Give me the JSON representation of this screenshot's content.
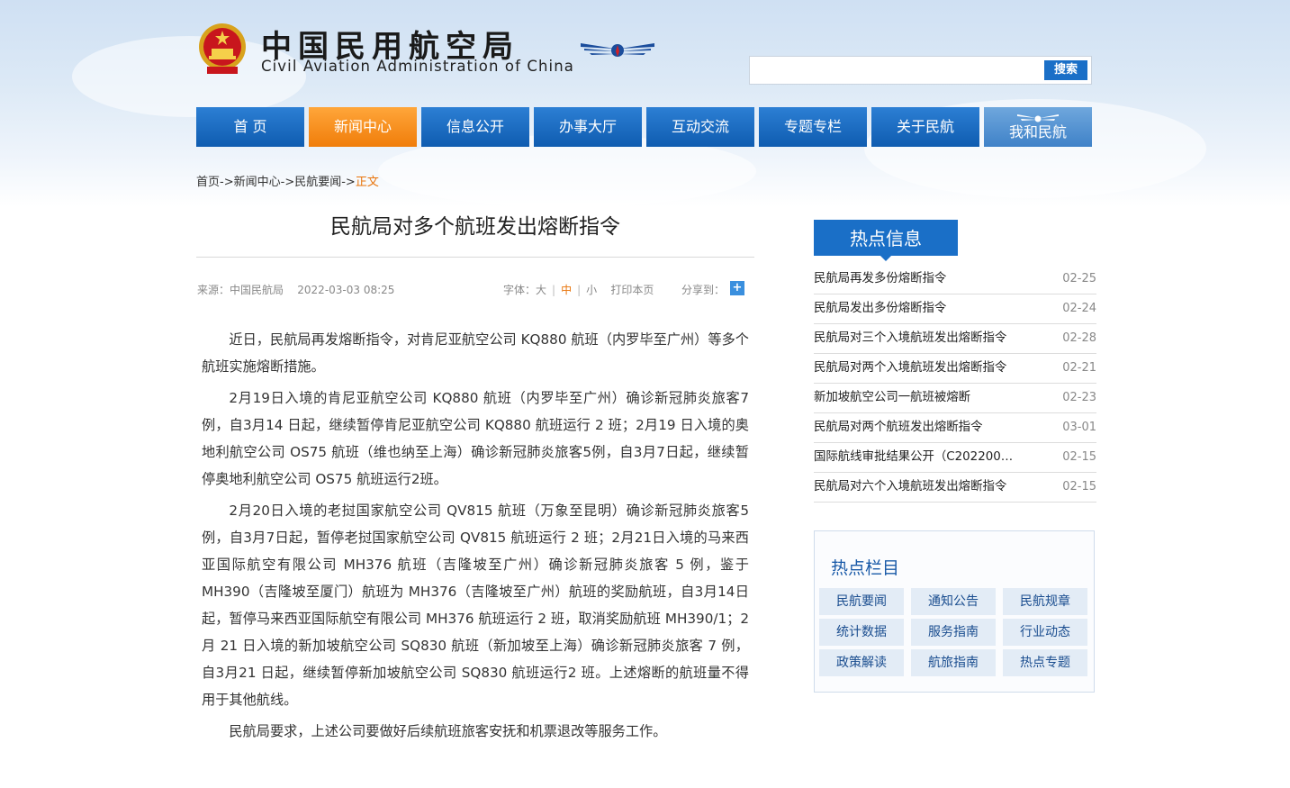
{
  "header": {
    "title_cn": "中国民用航空局",
    "title_en": "Civil Aviation Administration of China",
    "search": {
      "placeholder": "",
      "button_label": "搜索"
    }
  },
  "nav": {
    "items": [
      {
        "label": "首 页",
        "state": "normal"
      },
      {
        "label": "新闻中心",
        "state": "active"
      },
      {
        "label": "信息公开",
        "state": "normal"
      },
      {
        "label": "办事大厅",
        "state": "normal"
      },
      {
        "label": "互动交流",
        "state": "normal"
      },
      {
        "label": "专题专栏",
        "state": "normal"
      },
      {
        "label": "关于民航",
        "state": "normal"
      },
      {
        "label": "我和民航",
        "state": "special"
      }
    ]
  },
  "breadcrumb": {
    "home": "首页",
    "sep": "->",
    "news": "新闻中心",
    "section": "民航要闻",
    "current": "正文"
  },
  "article": {
    "title": "民航局对多个航班发出熔断指令",
    "source": "来源：中国民航局",
    "datetime": "2022-03-03 08:25",
    "font_label": "字体：",
    "font_large": "大",
    "font_medium": "中",
    "font_small": "小",
    "print": "打印本页",
    "share_label": "分享到：",
    "paragraphs": [
      "近日，民航局再发熔断指令，对肯尼亚航空公司 KQ880 航班（内罗毕至广州）等多个航班实施熔断措施。",
      "2月19日入境的肯尼亚航空公司 KQ880 航班（内罗毕至广州）确诊新冠肺炎旅客7 例，自3月14 日起，继续暂停肯尼亚航空公司 KQ880 航班运行 2 班；2月19 日入境的奥地利航空公司 OS75 航班（维也纳至上海）确诊新冠肺炎旅客5例，自3月7日起，继续暂停奥地利航空公司 OS75 航班运行2班。",
      "2月20日入境的老挝国家航空公司 QV815 航班（万象至昆明）确诊新冠肺炎旅客5例，自3月7日起，暂停老挝国家航空公司 QV815 航班运行 2 班；2月21日入境的马来西亚国际航空有限公司 MH376 航班（吉隆坡至广州）确诊新冠肺炎旅客 5 例，鉴于 MH390（吉隆坡至厦门）航班为 MH376（吉隆坡至广州）航班的奖励航班，自3月14日起，暂停马来西亚国际航空有限公司 MH376 航班运行 2 班，取消奖励航班 MH390/1；2 月 21 日入境的新加坡航空公司 SQ830 航班（新加坡至上海）确诊新冠肺炎旅客 7 例，自3月21 日起，继续暂停新加坡航空公司 SQ830 航班运行2 班。上述熔断的航班量不得用于其他航线。",
      "民航局要求，上述公司要做好后续航班旅客安抚和机票退改等服务工作。"
    ]
  },
  "hot_info": {
    "tab_label": "热点信息",
    "items": [
      {
        "title": "民航局再发多份熔断指令",
        "date": "02-25"
      },
      {
        "title": "民航局发出多份熔断指令",
        "date": "02-24"
      },
      {
        "title": "民航局对三个入境航班发出熔断指令",
        "date": "02-28"
      },
      {
        "title": "民航局对两个入境航班发出熔断指令",
        "date": "02-21"
      },
      {
        "title": "新加坡航空公司一航班被熔断",
        "date": "02-23"
      },
      {
        "title": "民航局对两个航班发出熔断指令",
        "date": "03-01"
      },
      {
        "title": "国际航线审批结果公开（C202200…",
        "date": "02-15"
      },
      {
        "title": "民航局对六个入境航班发出熔断指令",
        "date": "02-15"
      }
    ]
  },
  "hot_columns": {
    "title": "热点栏目",
    "items": [
      "民航要闻",
      "通知公告",
      "民航规章",
      "统计数据",
      "服务指南",
      "行业动态",
      "政策解读",
      "航旅指南",
      "热点专题"
    ]
  },
  "colors": {
    "nav_blue": "#1a6fc7",
    "nav_active": "#f58a1f",
    "accent_orange": "#e8740b",
    "column_title": "#1a5aa8"
  }
}
